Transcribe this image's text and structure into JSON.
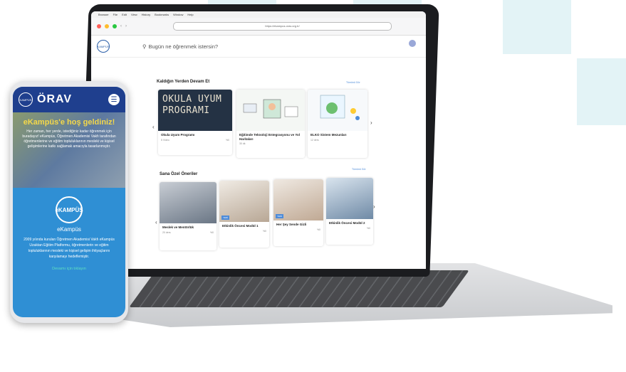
{
  "browser": {
    "menu_items": [
      "Browser",
      "File",
      "Edit",
      "View",
      "History",
      "Bookmarks",
      "Window",
      "Help"
    ],
    "url": "https://ekampus.orav.org.tr/"
  },
  "site": {
    "logo": "KAMPÜS",
    "search_placeholder": "Bugün ne öğrenmek istersin?"
  },
  "section1": {
    "title": "Kaldığın Yerden Devam Et",
    "see_all": "Tümünü Gör",
    "cards": [
      {
        "image_text": "OKULA UYUM PROGRAMI",
        "title": "Okula Uyum Programı",
        "meta": "5 Video",
        "pct": "%0"
      },
      {
        "image_text": "",
        "title": "Eğitimde Teknoloji Entegrasyonu ve Yol Haritaları",
        "meta": "30 dk"
      },
      {
        "image_text": "",
        "title": "ELKO Sistem Mezunları",
        "meta": "12 ders"
      }
    ]
  },
  "section2": {
    "title": "Sana Özel Öneriler",
    "see_all": "Tümünü Gör",
    "cards": [
      {
        "title": "Meslek ve Mentörlük",
        "meta": "20 ders",
        "tag": "",
        "pct": "%0"
      },
      {
        "title": "Etkinlik Öncesi Modül 1",
        "meta": "",
        "tag": "YENİ",
        "pct": "%0"
      },
      {
        "title": "Her Şey Sende Gizli",
        "meta": "",
        "tag": "YENİ",
        "pct": "%0"
      },
      {
        "title": "Etkinlik Öncesi Modül 2",
        "meta": "",
        "tag": "",
        "pct": "%0"
      }
    ]
  },
  "phone": {
    "brand": "ÖRAV",
    "logo": "KAMPÜS",
    "hero_title": "eKampüs'e hoş geldiniz!",
    "hero_text": "Her zaman, her yerde, istediğiniz kadar öğrenmek için buradayız! eKampüs, Öğretmen Akademisi Vakfı tarafından öğretmenlerine ve eğitim topluluklarının mesleki ve kişisel gelişimlerine katkı sağlamak amacıyla tasarlanmıştır.",
    "ek_logo": "eKAMPÜS",
    "ek_title": "eKampüs",
    "ek_desc": "2009 yılında kurulan Öğretmen Akademisi Vakfı eKampüs Uzaktan Eğitim Platformu, öğretmenlerin ve eğitim topluluklarının mesleki ve kişisel gelişim ihtiyaçlarını karşılamayı hedeflemiştir.",
    "ek_link": "Devamı için tıklayın"
  }
}
